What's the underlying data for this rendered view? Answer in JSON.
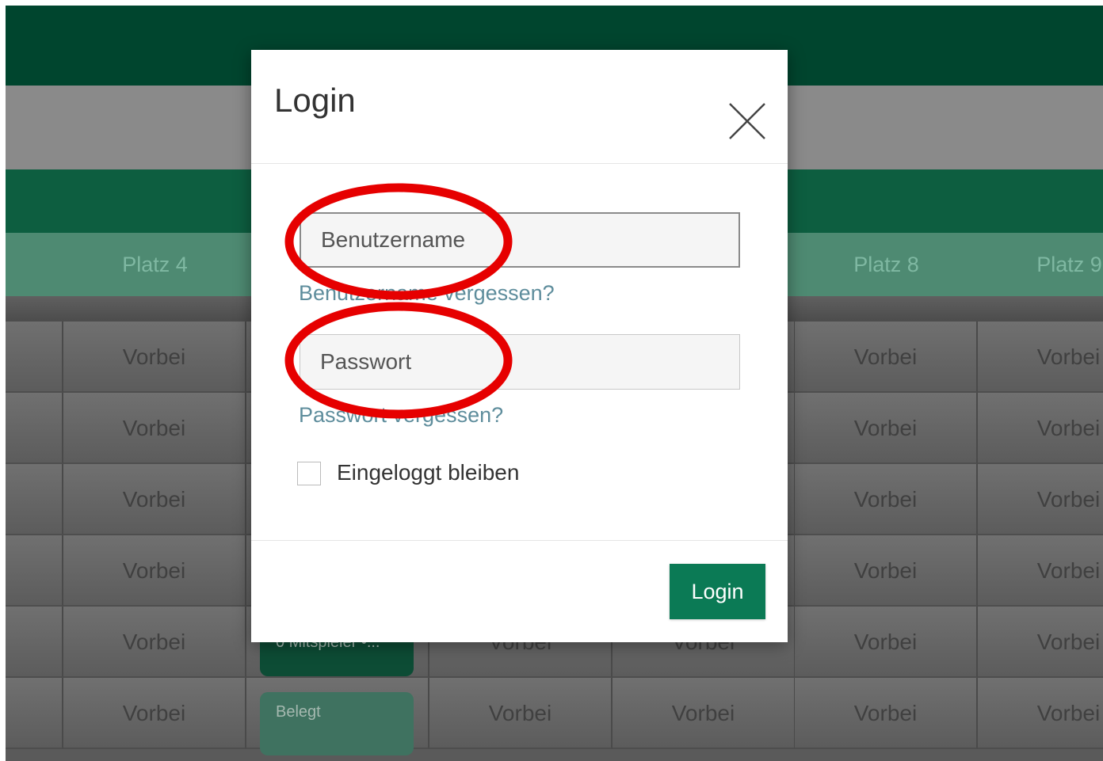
{
  "background": {
    "courts": [
      "Platz 4",
      "",
      "",
      "",
      "Platz 8",
      "Platz 9"
    ],
    "cell_text": "Vorbei",
    "tag_belegt": "Belegt",
    "tag_mitspieler": "0 Mitspieler •..."
  },
  "modal": {
    "title": "Login",
    "username_placeholder": "Benutzername",
    "username_forgot": "Benutzername vergessen?",
    "password_placeholder": "Passwort",
    "password_forgot": "Passwort vergessen?",
    "remember_label": "Eingeloggt bleiben",
    "login_button": "Login"
  },
  "colors": {
    "brand_green": "#0b7a55",
    "annotation_red": "#e60000"
  }
}
